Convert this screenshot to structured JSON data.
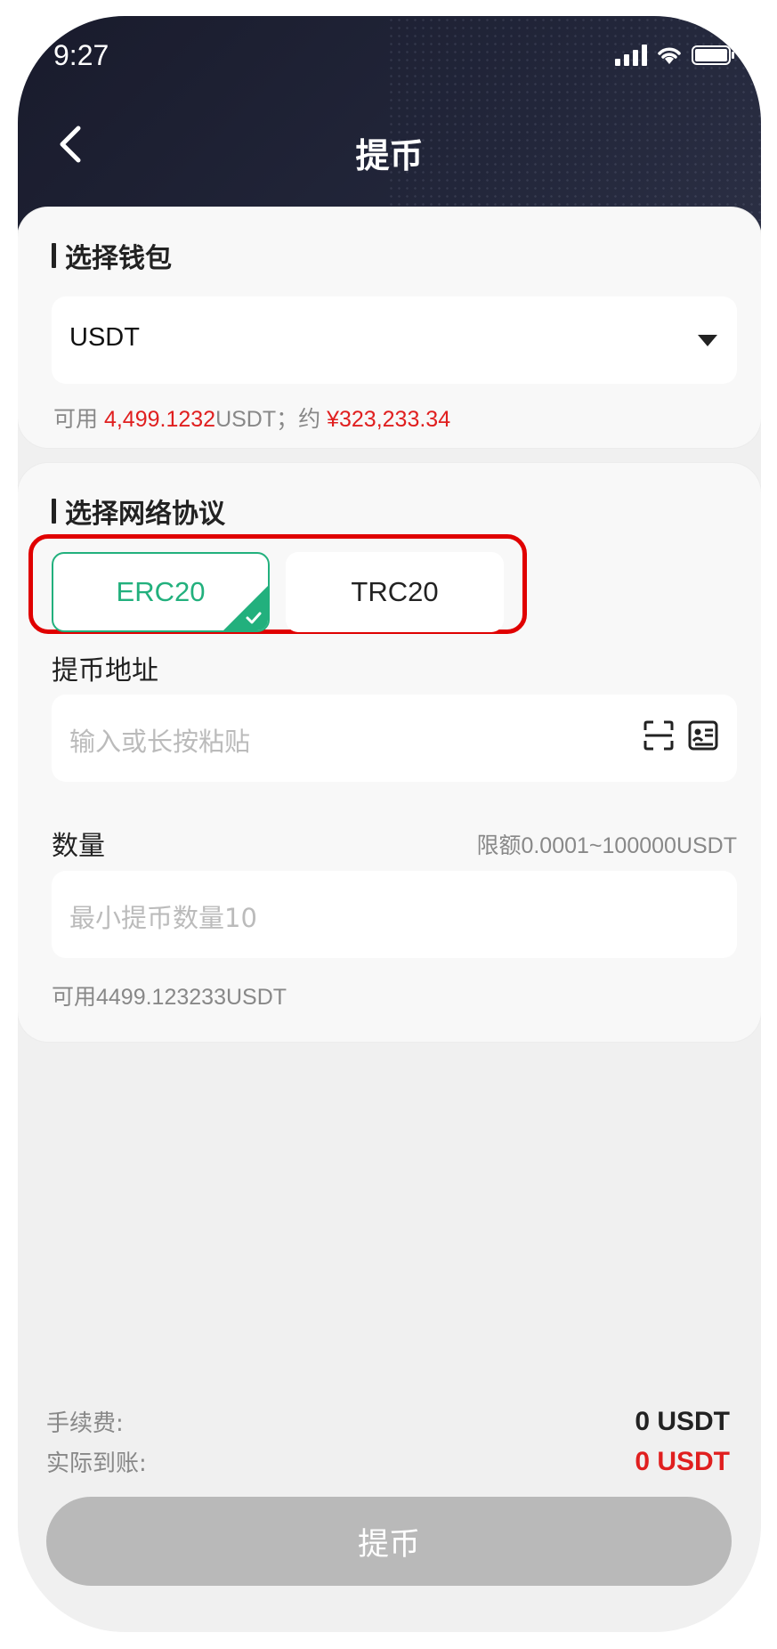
{
  "status": {
    "time": "9:27"
  },
  "header": {
    "title": "提币"
  },
  "wallet": {
    "section_title": "选择钱包",
    "selected": "USDT",
    "available_prefix": "可用 ",
    "available_amount": "4,499.1232",
    "available_mid": "USDT；约 ",
    "available_cny": "¥323,233.34"
  },
  "network": {
    "section_title": "选择网络协议",
    "options": [
      {
        "label": "ERC20",
        "selected": true
      },
      {
        "label": "TRC20",
        "selected": false
      }
    ]
  },
  "address": {
    "label": "提币地址",
    "placeholder": "输入或长按粘贴",
    "icons": [
      "scan-icon",
      "address-book-icon"
    ]
  },
  "amount": {
    "label": "数量",
    "limit": "限额0.0001~100000USDT",
    "placeholder": "最小提币数量10",
    "available": "可用4499.123233USDT"
  },
  "summary": {
    "fee_label": "手续费:",
    "fee_value": "0 USDT",
    "received_label": "实际到账:",
    "received_value": "0 USDT"
  },
  "submit_label": "提币",
  "colors": {
    "accent_green": "#22b07d",
    "highlight_red": "#e00000",
    "value_red": "#e01f1f",
    "header_dark": "#191b2c"
  }
}
